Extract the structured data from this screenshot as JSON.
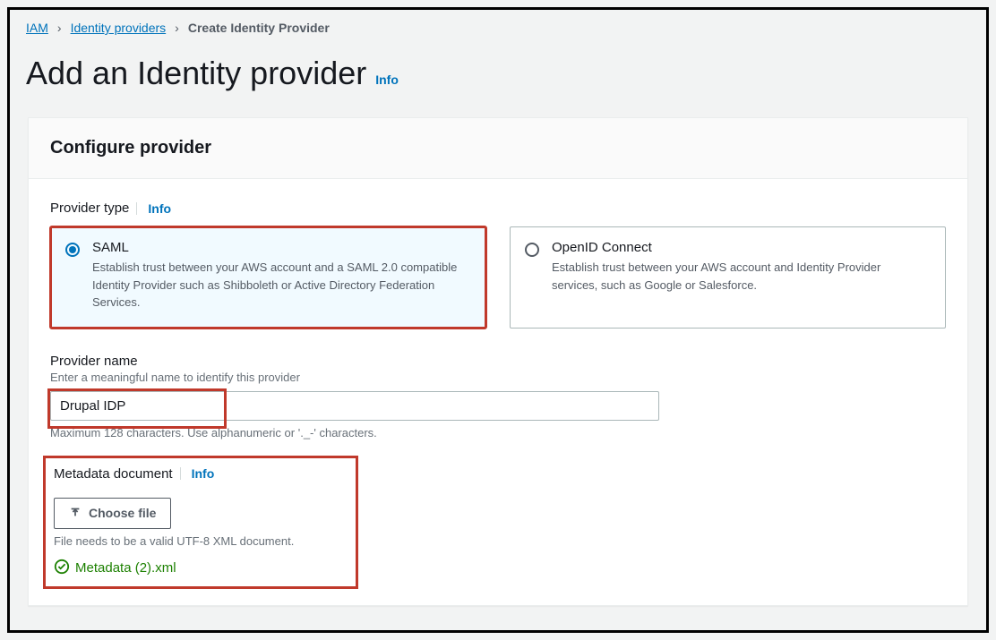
{
  "breadcrumb": {
    "items": [
      "IAM",
      "Identity providers",
      "Create Identity Provider"
    ]
  },
  "page": {
    "title": "Add an Identity provider",
    "info_label": "Info"
  },
  "panel": {
    "header": "Configure provider",
    "provider_type": {
      "label": "Provider type",
      "info_label": "Info",
      "options": [
        {
          "title": "SAML",
          "desc": "Establish trust between your AWS account and a SAML 2.0 compatible Identity Provider such as Shibboleth or Active Directory Federation Services.",
          "selected": true
        },
        {
          "title": "OpenID Connect",
          "desc": "Establish trust between your AWS account and Identity Provider services, such as Google or Salesforce.",
          "selected": false
        }
      ]
    },
    "provider_name": {
      "label": "Provider name",
      "hint": "Enter a meaningful name to identify this provider",
      "value": "Drupal IDP",
      "constraint": "Maximum 128 characters. Use alphanumeric or '._-' characters."
    },
    "metadata": {
      "label": "Metadata document",
      "info_label": "Info",
      "button_label": "Choose file",
      "hint": "File needs to be a valid UTF-8 XML document.",
      "filename": "Metadata (2).xml"
    }
  }
}
